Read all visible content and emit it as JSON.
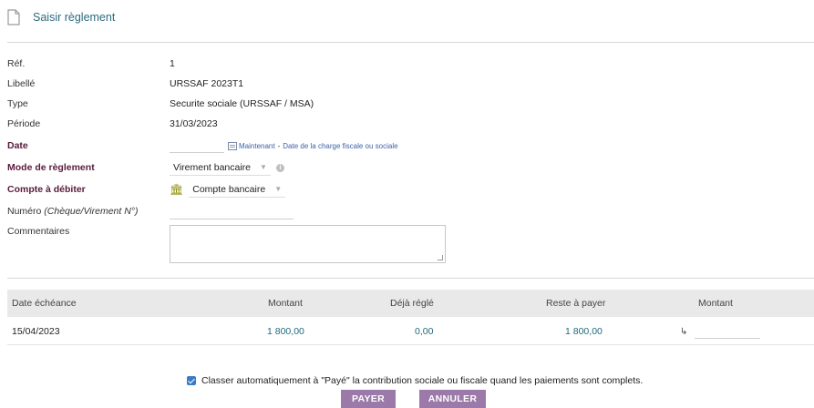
{
  "header": {
    "title": "Saisir règlement",
    "icon": "document-icon"
  },
  "fields": {
    "ref": {
      "label": "Réf.",
      "value": "1"
    },
    "libelle": {
      "label": "Libellé",
      "value": "URSSAF 2023T1"
    },
    "type": {
      "label": "Type",
      "value": "Securite sociale (URSSAF / MSA)"
    },
    "periode": {
      "label": "Période",
      "value": "31/03/2023"
    },
    "date": {
      "label": "Date",
      "value": "",
      "now_link": "Maintenant",
      "separator": "-",
      "tax_date_link": "Date de la charge fiscale ou sociale"
    },
    "mode": {
      "label": "Mode de règlement",
      "selected": "Virement bancaire"
    },
    "compte": {
      "label": "Compte à débiter",
      "selected": "Compte bancaire"
    },
    "numero": {
      "label_prefix": "Numéro",
      "label_italic": "(Chèque/Virement N°)",
      "value": ""
    },
    "commentaires": {
      "label": "Commentaires",
      "value": ""
    }
  },
  "table": {
    "headers": [
      "Date échéance",
      "Montant",
      "Déjà réglé",
      "Reste à payer",
      "Montant"
    ],
    "rows": [
      {
        "date": "15/04/2023",
        "montant": "1 800,00",
        "deja_regle": "0,00",
        "reste": "1 800,00",
        "arrow": "↳",
        "payment": ""
      }
    ]
  },
  "auto_classify": {
    "checked": true,
    "label": "Classer automatiquement à \"Payé\" la contribution sociale ou fiscale quand les paiements sont complets."
  },
  "buttons": {
    "pay": "PAYER",
    "cancel": "ANNULER"
  },
  "colors": {
    "accent": "#9b79a8",
    "label_bold": "#5a1a3c",
    "link": "#3a63a6",
    "number": "#1f6a7a"
  }
}
